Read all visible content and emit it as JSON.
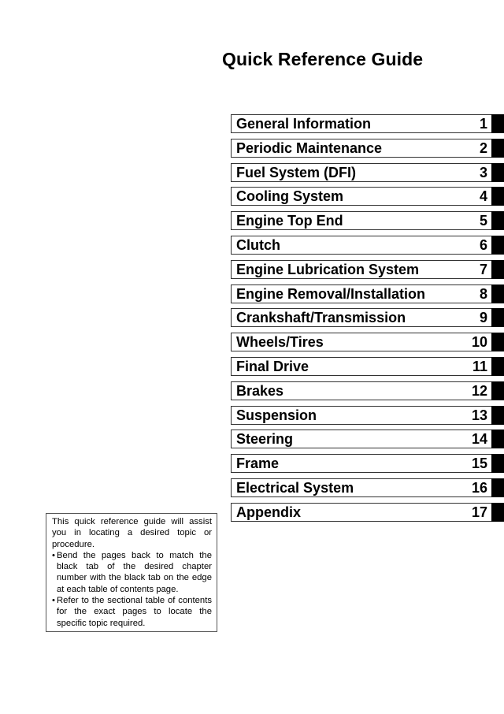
{
  "header": {
    "title": "Quick Reference Guide"
  },
  "toc": {
    "chapters": [
      {
        "label": "General Information",
        "number": "1"
      },
      {
        "label": "Periodic Maintenance",
        "number": "2"
      },
      {
        "label": "Fuel System (DFI)",
        "number": "3"
      },
      {
        "label": "Cooling System",
        "number": "4"
      },
      {
        "label": "Engine Top End",
        "number": "5"
      },
      {
        "label": "Clutch",
        "number": "6"
      },
      {
        "label": "Engine Lubrication System",
        "number": "7"
      },
      {
        "label": "Engine Removal/Installation",
        "number": "8"
      },
      {
        "label": "Crankshaft/Transmission",
        "number": "9"
      },
      {
        "label": "Wheels/Tires",
        "number": "10"
      },
      {
        "label": "Final Drive",
        "number": "11"
      },
      {
        "label": "Brakes",
        "number": "12"
      },
      {
        "label": "Suspension",
        "number": "13"
      },
      {
        "label": "Steering",
        "number": "14"
      },
      {
        "label": "Frame",
        "number": "15"
      },
      {
        "label": "Electrical System",
        "number": "16"
      },
      {
        "label": "Appendix",
        "number": "17"
      }
    ],
    "tab_color": "#000000"
  },
  "info": {
    "intro": "This quick reference guide will assist you in locating a desired topic or procedure.",
    "bullet_symbol": "•",
    "bullets": [
      "Bend the pages back to match the black tab of the desired chapter number with the black tab on the edge at each table of contents page.",
      "Refer to the sectional table of contents for the exact pages to locate the specific topic required."
    ]
  }
}
